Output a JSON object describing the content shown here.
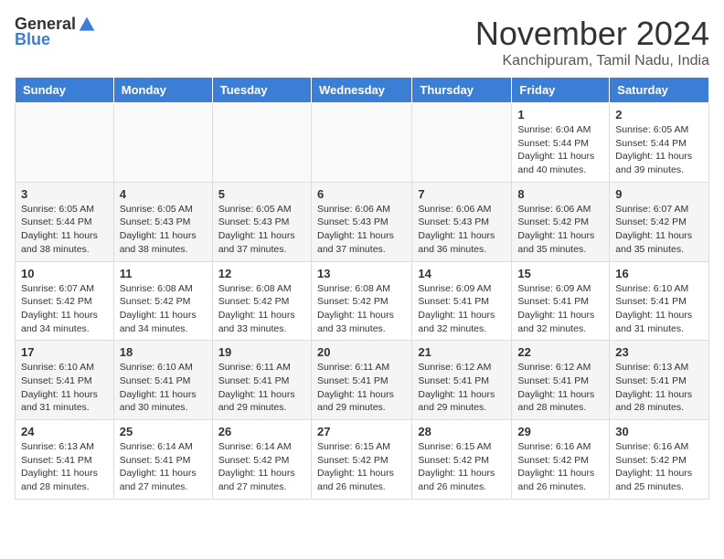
{
  "header": {
    "logo_general": "General",
    "logo_blue": "Blue",
    "month_title": "November 2024",
    "location": "Kanchipuram, Tamil Nadu, India"
  },
  "weekdays": [
    "Sunday",
    "Monday",
    "Tuesday",
    "Wednesday",
    "Thursday",
    "Friday",
    "Saturday"
  ],
  "weeks": [
    [
      {
        "day": "",
        "info": ""
      },
      {
        "day": "",
        "info": ""
      },
      {
        "day": "",
        "info": ""
      },
      {
        "day": "",
        "info": ""
      },
      {
        "day": "",
        "info": ""
      },
      {
        "day": "1",
        "info": "Sunrise: 6:04 AM\nSunset: 5:44 PM\nDaylight: 11 hours and 40 minutes."
      },
      {
        "day": "2",
        "info": "Sunrise: 6:05 AM\nSunset: 5:44 PM\nDaylight: 11 hours and 39 minutes."
      }
    ],
    [
      {
        "day": "3",
        "info": "Sunrise: 6:05 AM\nSunset: 5:44 PM\nDaylight: 11 hours and 38 minutes."
      },
      {
        "day": "4",
        "info": "Sunrise: 6:05 AM\nSunset: 5:43 PM\nDaylight: 11 hours and 38 minutes."
      },
      {
        "day": "5",
        "info": "Sunrise: 6:05 AM\nSunset: 5:43 PM\nDaylight: 11 hours and 37 minutes."
      },
      {
        "day": "6",
        "info": "Sunrise: 6:06 AM\nSunset: 5:43 PM\nDaylight: 11 hours and 37 minutes."
      },
      {
        "day": "7",
        "info": "Sunrise: 6:06 AM\nSunset: 5:43 PM\nDaylight: 11 hours and 36 minutes."
      },
      {
        "day": "8",
        "info": "Sunrise: 6:06 AM\nSunset: 5:42 PM\nDaylight: 11 hours and 35 minutes."
      },
      {
        "day": "9",
        "info": "Sunrise: 6:07 AM\nSunset: 5:42 PM\nDaylight: 11 hours and 35 minutes."
      }
    ],
    [
      {
        "day": "10",
        "info": "Sunrise: 6:07 AM\nSunset: 5:42 PM\nDaylight: 11 hours and 34 minutes."
      },
      {
        "day": "11",
        "info": "Sunrise: 6:08 AM\nSunset: 5:42 PM\nDaylight: 11 hours and 34 minutes."
      },
      {
        "day": "12",
        "info": "Sunrise: 6:08 AM\nSunset: 5:42 PM\nDaylight: 11 hours and 33 minutes."
      },
      {
        "day": "13",
        "info": "Sunrise: 6:08 AM\nSunset: 5:42 PM\nDaylight: 11 hours and 33 minutes."
      },
      {
        "day": "14",
        "info": "Sunrise: 6:09 AM\nSunset: 5:41 PM\nDaylight: 11 hours and 32 minutes."
      },
      {
        "day": "15",
        "info": "Sunrise: 6:09 AM\nSunset: 5:41 PM\nDaylight: 11 hours and 32 minutes."
      },
      {
        "day": "16",
        "info": "Sunrise: 6:10 AM\nSunset: 5:41 PM\nDaylight: 11 hours and 31 minutes."
      }
    ],
    [
      {
        "day": "17",
        "info": "Sunrise: 6:10 AM\nSunset: 5:41 PM\nDaylight: 11 hours and 31 minutes."
      },
      {
        "day": "18",
        "info": "Sunrise: 6:10 AM\nSunset: 5:41 PM\nDaylight: 11 hours and 30 minutes."
      },
      {
        "day": "19",
        "info": "Sunrise: 6:11 AM\nSunset: 5:41 PM\nDaylight: 11 hours and 29 minutes."
      },
      {
        "day": "20",
        "info": "Sunrise: 6:11 AM\nSunset: 5:41 PM\nDaylight: 11 hours and 29 minutes."
      },
      {
        "day": "21",
        "info": "Sunrise: 6:12 AM\nSunset: 5:41 PM\nDaylight: 11 hours and 29 minutes."
      },
      {
        "day": "22",
        "info": "Sunrise: 6:12 AM\nSunset: 5:41 PM\nDaylight: 11 hours and 28 minutes."
      },
      {
        "day": "23",
        "info": "Sunrise: 6:13 AM\nSunset: 5:41 PM\nDaylight: 11 hours and 28 minutes."
      }
    ],
    [
      {
        "day": "24",
        "info": "Sunrise: 6:13 AM\nSunset: 5:41 PM\nDaylight: 11 hours and 28 minutes."
      },
      {
        "day": "25",
        "info": "Sunrise: 6:14 AM\nSunset: 5:41 PM\nDaylight: 11 hours and 27 minutes."
      },
      {
        "day": "26",
        "info": "Sunrise: 6:14 AM\nSunset: 5:42 PM\nDaylight: 11 hours and 27 minutes."
      },
      {
        "day": "27",
        "info": "Sunrise: 6:15 AM\nSunset: 5:42 PM\nDaylight: 11 hours and 26 minutes."
      },
      {
        "day": "28",
        "info": "Sunrise: 6:15 AM\nSunset: 5:42 PM\nDaylight: 11 hours and 26 minutes."
      },
      {
        "day": "29",
        "info": "Sunrise: 6:16 AM\nSunset: 5:42 PM\nDaylight: 11 hours and 26 minutes."
      },
      {
        "day": "30",
        "info": "Sunrise: 6:16 AM\nSunset: 5:42 PM\nDaylight: 11 hours and 25 minutes."
      }
    ]
  ]
}
